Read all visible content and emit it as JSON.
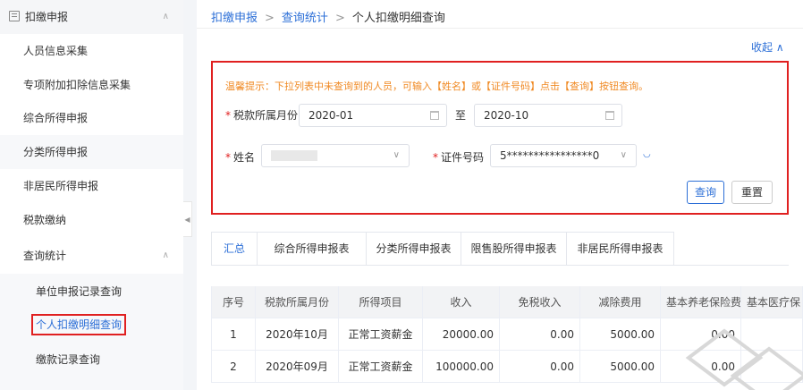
{
  "sidebar": {
    "top_item": "扣缴申报",
    "items": [
      "人员信息采集",
      "专项附加扣除信息采集",
      "综合所得申报",
      "分类所得申报",
      "非居民所得申报",
      "税款缴纳",
      "查询统计"
    ],
    "sub_items": [
      "单位申报记录查询",
      "个人扣缴明细查询",
      "缴款记录查询"
    ]
  },
  "breadcrumb": {
    "item1": "扣缴申报",
    "sep": ">",
    "item2": "查询统计",
    "item3": "个人扣缴明细查询"
  },
  "collapse": "收起 ∧",
  "filter": {
    "tip": "温馨提示：下拉列表中未查询到的人员，可输入【姓名】或【证件号码】点击【查询】按钮查询。",
    "period_label": "税款所属月份",
    "period_start": "2020-01",
    "period_to": "至",
    "period_end": "2020-10",
    "name_label": "姓名",
    "id_label": "证件号码",
    "id_value": "5****************0",
    "query_btn": "查询",
    "reset_btn": "重置"
  },
  "tabs": [
    "汇总",
    "综合所得申报表",
    "分类所得申报表",
    "限售股所得申报表",
    "非居民所得申报表"
  ],
  "table": {
    "headers": [
      "序号",
      "税款所属月份",
      "所得项目",
      "收入",
      "免税收入",
      "减除费用",
      "基本养老保险费",
      "基本医疗保"
    ],
    "rows": [
      [
        "1",
        "2020年10月",
        "正常工资薪金",
        "20000.00",
        "0.00",
        "5000.00",
        "0.00",
        ""
      ],
      [
        "2",
        "2020年09月",
        "正常工资薪金",
        "100000.00",
        "0.00",
        "5000.00",
        "0.00",
        ""
      ]
    ]
  },
  "colors": {
    "accent": "#2c6fd7",
    "highlight": "#e02020",
    "tip": "#f08a24"
  }
}
